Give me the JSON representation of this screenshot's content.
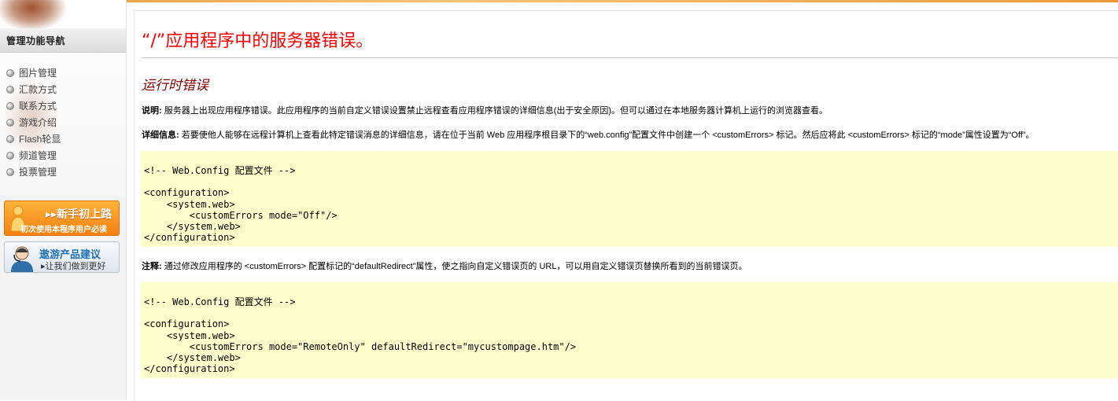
{
  "sidebar": {
    "header": "管理功能导航",
    "items": [
      {
        "label": "图片管理"
      },
      {
        "label": "汇款方式"
      },
      {
        "label": "联系方式"
      },
      {
        "label": "游戏介绍"
      },
      {
        "label": "Flash轮显"
      },
      {
        "label": "频道管理"
      },
      {
        "label": "投票管理"
      }
    ],
    "banner_new": {
      "title": "▸▸新手初上路",
      "subtitle": "初次使用本程序用户必读"
    },
    "banner_suggest": {
      "title": "遨游产品建议",
      "subtitle": "▸让我们做到更好"
    }
  },
  "page": {
    "title": "“/”应用程序中的服务器错误。",
    "subtitle": "运行时错误",
    "desc_label": "说明:",
    "desc_text": " 服务器上出现应用程序错误。此应用程序的当前自定义错误设置禁止远程查看应用程序错误的详细信息(出于安全原因)。但可以通过在本地服务器计算机上运行的浏览器查看。",
    "detail_label": "详细信息:",
    "detail_text": " 若要使他人能够在远程计算机上查看此特定错误消息的详细信息，请在位于当前 Web 应用程序根目录下的“web.config”配置文件中创建一个 <customErrors> 标记。然后应将此 <customErrors> 标记的“mode”属性设置为“Off”。",
    "code1": "<!-- Web.Config 配置文件 -->\n\n<configuration>\n    <system.web>\n        <customErrors mode=\"Off\"/>\n    </system.web>\n</configuration>",
    "note_label": "注释:",
    "note_text": " 通过修改应用程序的 <customErrors> 配置标记的“defaultRedirect”属性，使之指向自定义错误页的 URL，可以用自定义错误页替换所看到的当前错误页。",
    "code2": "<!-- Web.Config 配置文件 -->\n\n<configuration>\n    <system.web>\n        <customErrors mode=\"RemoteOnly\" defaultRedirect=\"mycustompage.htm\"/>\n    </system.web>\n</configuration>"
  },
  "colors": {
    "title_red": "#ff0000",
    "subtitle_maroon": "#800000",
    "code_bg": "#ffffcc",
    "accent_orange": "#f57f12"
  }
}
